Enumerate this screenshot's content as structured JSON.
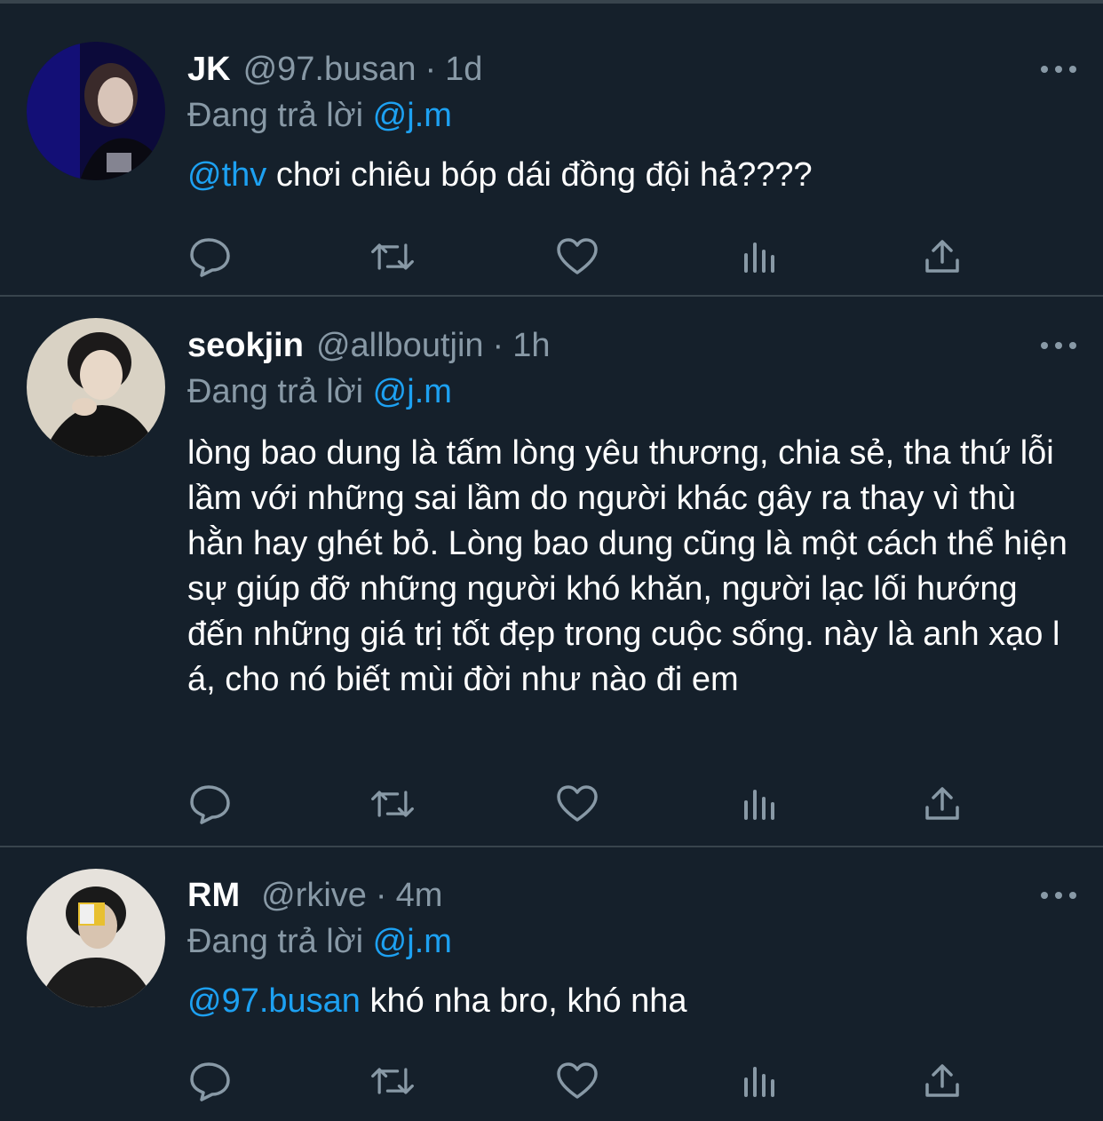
{
  "colors": {
    "background": "#15202b",
    "divider": "#38444d",
    "muted": "#8899a6",
    "link": "#1da1f2",
    "text": "#ffffff"
  },
  "tweets": [
    {
      "display_name": "JK",
      "handle": "@97.busan",
      "separator": "·",
      "time": "1d",
      "reply_prefix": "Đang trả lời",
      "reply_to": "@j.m",
      "mention": "@thv",
      "text": " chơi chiêu bóp dái đồng đội hả????"
    },
    {
      "display_name": "seokjin",
      "handle": "@allboutjin",
      "separator": "·",
      "time": "1h",
      "reply_prefix": "Đang trả lời",
      "reply_to": "@j.m",
      "mention": "",
      "text": "lòng bao dung là tấm lòng yêu thương, chia sẻ, tha thứ lỗi lầm với những sai lầm do người khác gây ra thay vì thù hằn hay ghét bỏ. Lòng bao dung cũng là một cách thể hiện sự giúp đỡ những người khó khăn, người lạc lối hướng đến những giá trị tốt đẹp trong cuộc sống. này là anh xạo l á, cho nó biết mùi đời như nào đi em"
    },
    {
      "display_name": "RM",
      "handle": "@rkive",
      "separator": "·",
      "time": "4m",
      "reply_prefix": "Đang trả lời",
      "reply_to": "@j.m",
      "mention": "@97.busan",
      "text": " khó nha bro, khó nha"
    }
  ],
  "icons": {
    "reply": "reply-icon",
    "retweet": "retweet-icon",
    "like": "like-icon",
    "analytics": "analytics-icon",
    "share": "share-icon",
    "more": "more-icon"
  }
}
